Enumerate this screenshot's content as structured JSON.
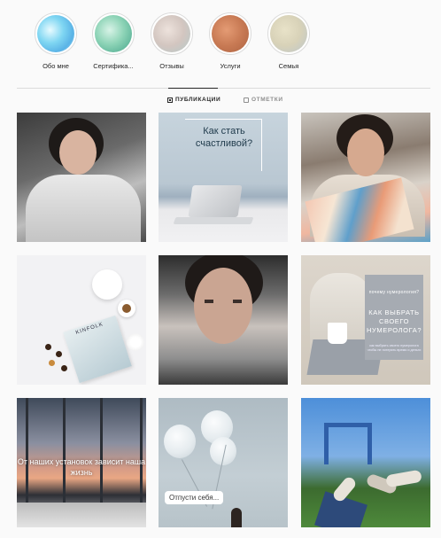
{
  "highlights": [
    {
      "label": "Обо мне",
      "color": "#7fd6f2"
    },
    {
      "label": "Сертифика...",
      "color": "#8ed4b7"
    },
    {
      "label": "Отзывы",
      "color": "#d3c6c0"
    },
    {
      "label": "Услуги",
      "color": "#c87a54"
    },
    {
      "label": "Семья",
      "color": "#d8d2b8"
    }
  ],
  "tabs": [
    {
      "label": "ПУБЛИКАЦИИ",
      "icon": "grid-icon",
      "active": true
    },
    {
      "label": "ОТМЕТКИ",
      "icon": "tag-icon",
      "active": false
    }
  ],
  "posts": {
    "p2_headline": "Как стать счастливой?",
    "p4_magazine": "KINFOLK",
    "p6_pre": "почему нумерология?",
    "p6_title": "КАК ВЫБРАТЬ СВОЕГО НУМЕРОЛОГА?",
    "p6_small": "как выбрать своего нумеролога чтобы не потерять время и деньги",
    "p7_caption": "От наших установок зависит наша жизнь",
    "p8_caption": "Отпусти себя..."
  },
  "colors": {
    "accent_text": "#262626",
    "muted_text": "#8e8e8e",
    "divider": "#dbdbdb"
  }
}
